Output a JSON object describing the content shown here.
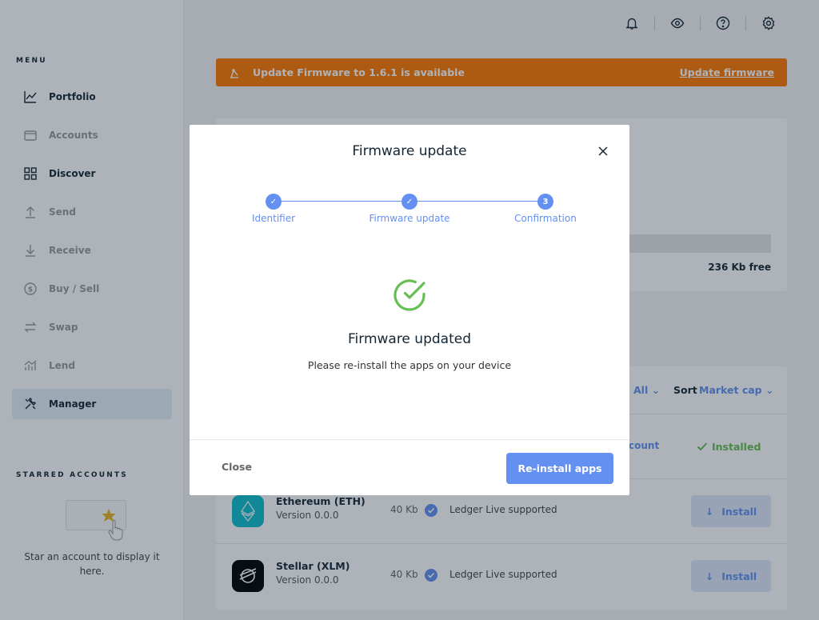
{
  "sidebar": {
    "menu_title": "MENU",
    "items": [
      {
        "label": "Portfolio",
        "icon": "chart-icon"
      },
      {
        "label": "Accounts",
        "icon": "wallet-icon"
      },
      {
        "label": "Discover",
        "icon": "grid-icon"
      },
      {
        "label": "Send",
        "icon": "send-icon"
      },
      {
        "label": "Receive",
        "icon": "receive-icon"
      },
      {
        "label": "Buy / Sell",
        "icon": "dollar-icon"
      },
      {
        "label": "Swap",
        "icon": "swap-icon"
      },
      {
        "label": "Lend",
        "icon": "lend-icon"
      },
      {
        "label": "Manager",
        "icon": "tools-icon"
      }
    ],
    "starred_title": "STARRED ACCOUNTS",
    "starred_empty_text": "Star an account to display it here."
  },
  "topbar": {
    "icons": [
      "bell-icon",
      "eye-icon",
      "help-icon",
      "settings-icon"
    ]
  },
  "banner": {
    "text": "Update Firmware to 1.6.1 is available",
    "link": "Update firmware",
    "color": "#ff7701"
  },
  "background": {
    "storage_free": "236 Kb free",
    "filter_value": "All",
    "sort_label": "Sort",
    "sort_value": "Market cap",
    "account_link": "count",
    "installed_label": "Installed",
    "apps": [
      {
        "name": "Ethereum (ETH)",
        "version": "Version 0.0.0",
        "size": "40 Kb",
        "support": "Ledger Live supported",
        "action": "Install"
      },
      {
        "name": "Stellar (XLM)",
        "version": "Version 0.0.0",
        "size": "40 Kb",
        "support": "Ledger Live supported",
        "action": "Install"
      }
    ]
  },
  "modal": {
    "title": "Firmware update",
    "steps": [
      {
        "label": "Identifier",
        "state": "done",
        "marker": "✓"
      },
      {
        "label": "Firmware update",
        "state": "done",
        "marker": "✓"
      },
      {
        "label": "Confirmation",
        "state": "current",
        "marker": "3"
      }
    ],
    "success_title": "Firmware updated",
    "success_subtitle": "Please re-install the apps on your device",
    "close_label": "Close",
    "primary_label": "Re-install apps"
  },
  "colors": {
    "accent": "#6490f1",
    "success": "#66be54",
    "text": "#142533"
  }
}
